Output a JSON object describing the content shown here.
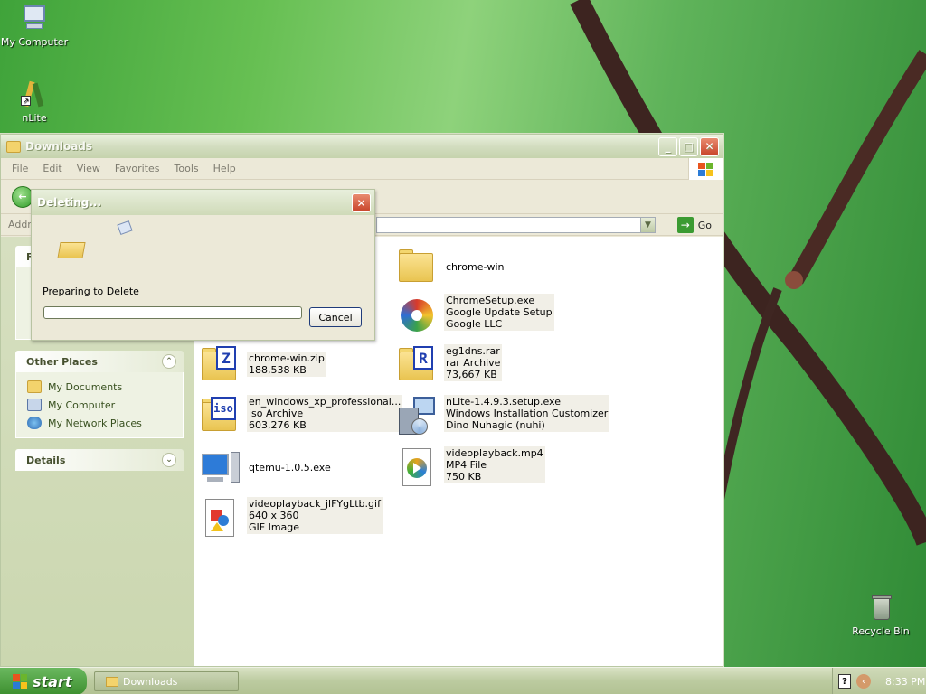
{
  "desktop": {
    "icons": [
      {
        "label": "My Computer"
      },
      {
        "label": "nLite"
      },
      {
        "label": "Recycle Bin"
      }
    ]
  },
  "explorer": {
    "title": "Downloads",
    "menu": [
      "File",
      "Edit",
      "View",
      "Favorites",
      "Tools",
      "Help"
    ],
    "address_label": "Addre",
    "go_label": "Go",
    "side_panel": {
      "file_tasks_head": "F",
      "other_places": {
        "title": "Other Places",
        "links": [
          "My Documents",
          "My Computer",
          "My Network Places"
        ]
      },
      "details_title": "Details"
    },
    "items": [
      {
        "lines": [
          "chrome-win"
        ],
        "icon": "folder-icon"
      },
      {
        "lines": [
          "ChromeSetup.exe",
          "Google Update Setup",
          "Google LLC"
        ],
        "icon": "installer-icon"
      },
      {
        "lines": [
          "chrome-win.zip",
          "188,538 KB"
        ],
        "icon": "zip-archive-icon",
        "badge": "Z"
      },
      {
        "lines": [
          "eg1dns.rar",
          "rar Archive",
          "73,667 KB"
        ],
        "icon": "rar-archive-icon",
        "badge": "R"
      },
      {
        "lines": [
          "en_windows_xp_professional...",
          "iso Archive",
          "603,276 KB"
        ],
        "icon": "iso-archive-icon",
        "badge": "iso"
      },
      {
        "lines": [
          "nLite-1.4.9.3.setup.exe",
          "Windows Installation Customizer",
          "Dino Nuhagic (nuhi)"
        ],
        "icon": "setup-icon"
      },
      {
        "lines": [
          "qtemu-1.0.5.exe"
        ],
        "icon": "computer-app-icon"
      },
      {
        "lines": [
          "videoplayback.mp4",
          "MP4 File",
          "750 KB"
        ],
        "icon": "media-file-icon"
      },
      {
        "lines": [
          "videoplayback_jlFYgLtb.gif",
          "640 x 360",
          "GIF Image"
        ],
        "icon": "image-file-icon"
      }
    ]
  },
  "dialog": {
    "title": "Deleting...",
    "status": "Preparing to Delete",
    "progress": 0,
    "cancel_label": "Cancel"
  },
  "taskbar": {
    "start_label": "start",
    "task_label": "Downloads",
    "clock": "8:33 PM"
  }
}
